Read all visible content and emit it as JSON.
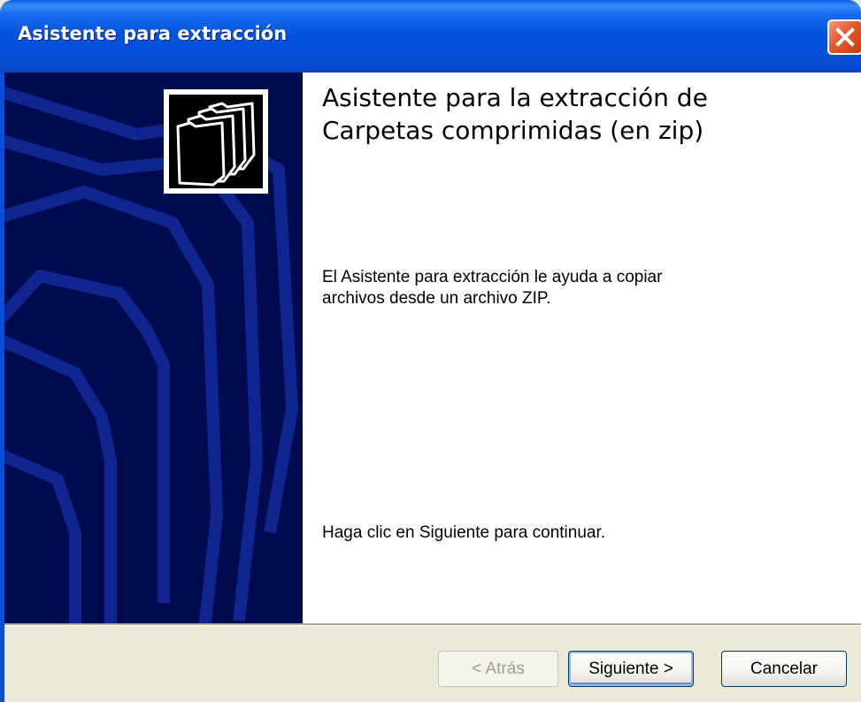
{
  "window": {
    "title": "Asistente para extracción",
    "close_icon": "close-icon",
    "colors": {
      "titlebar": "#0553e1",
      "side_panel": "#000a4e",
      "close": "#e25a2e",
      "dialog": "#ece9d8"
    }
  },
  "side_panel": {
    "logo_icon": "compressed-folders-icon"
  },
  "content": {
    "heading": "Asistente para la extracción de Carpetas comprimidas (en zip)",
    "description": "El Asistente para extracción le ayuda a copiar archivos desde un archivo ZIP.",
    "continue_hint": "Haga clic en Siguiente para continuar."
  },
  "buttons": {
    "back": "< Atrás",
    "next": "Siguiente >",
    "cancel": "Cancelar"
  }
}
